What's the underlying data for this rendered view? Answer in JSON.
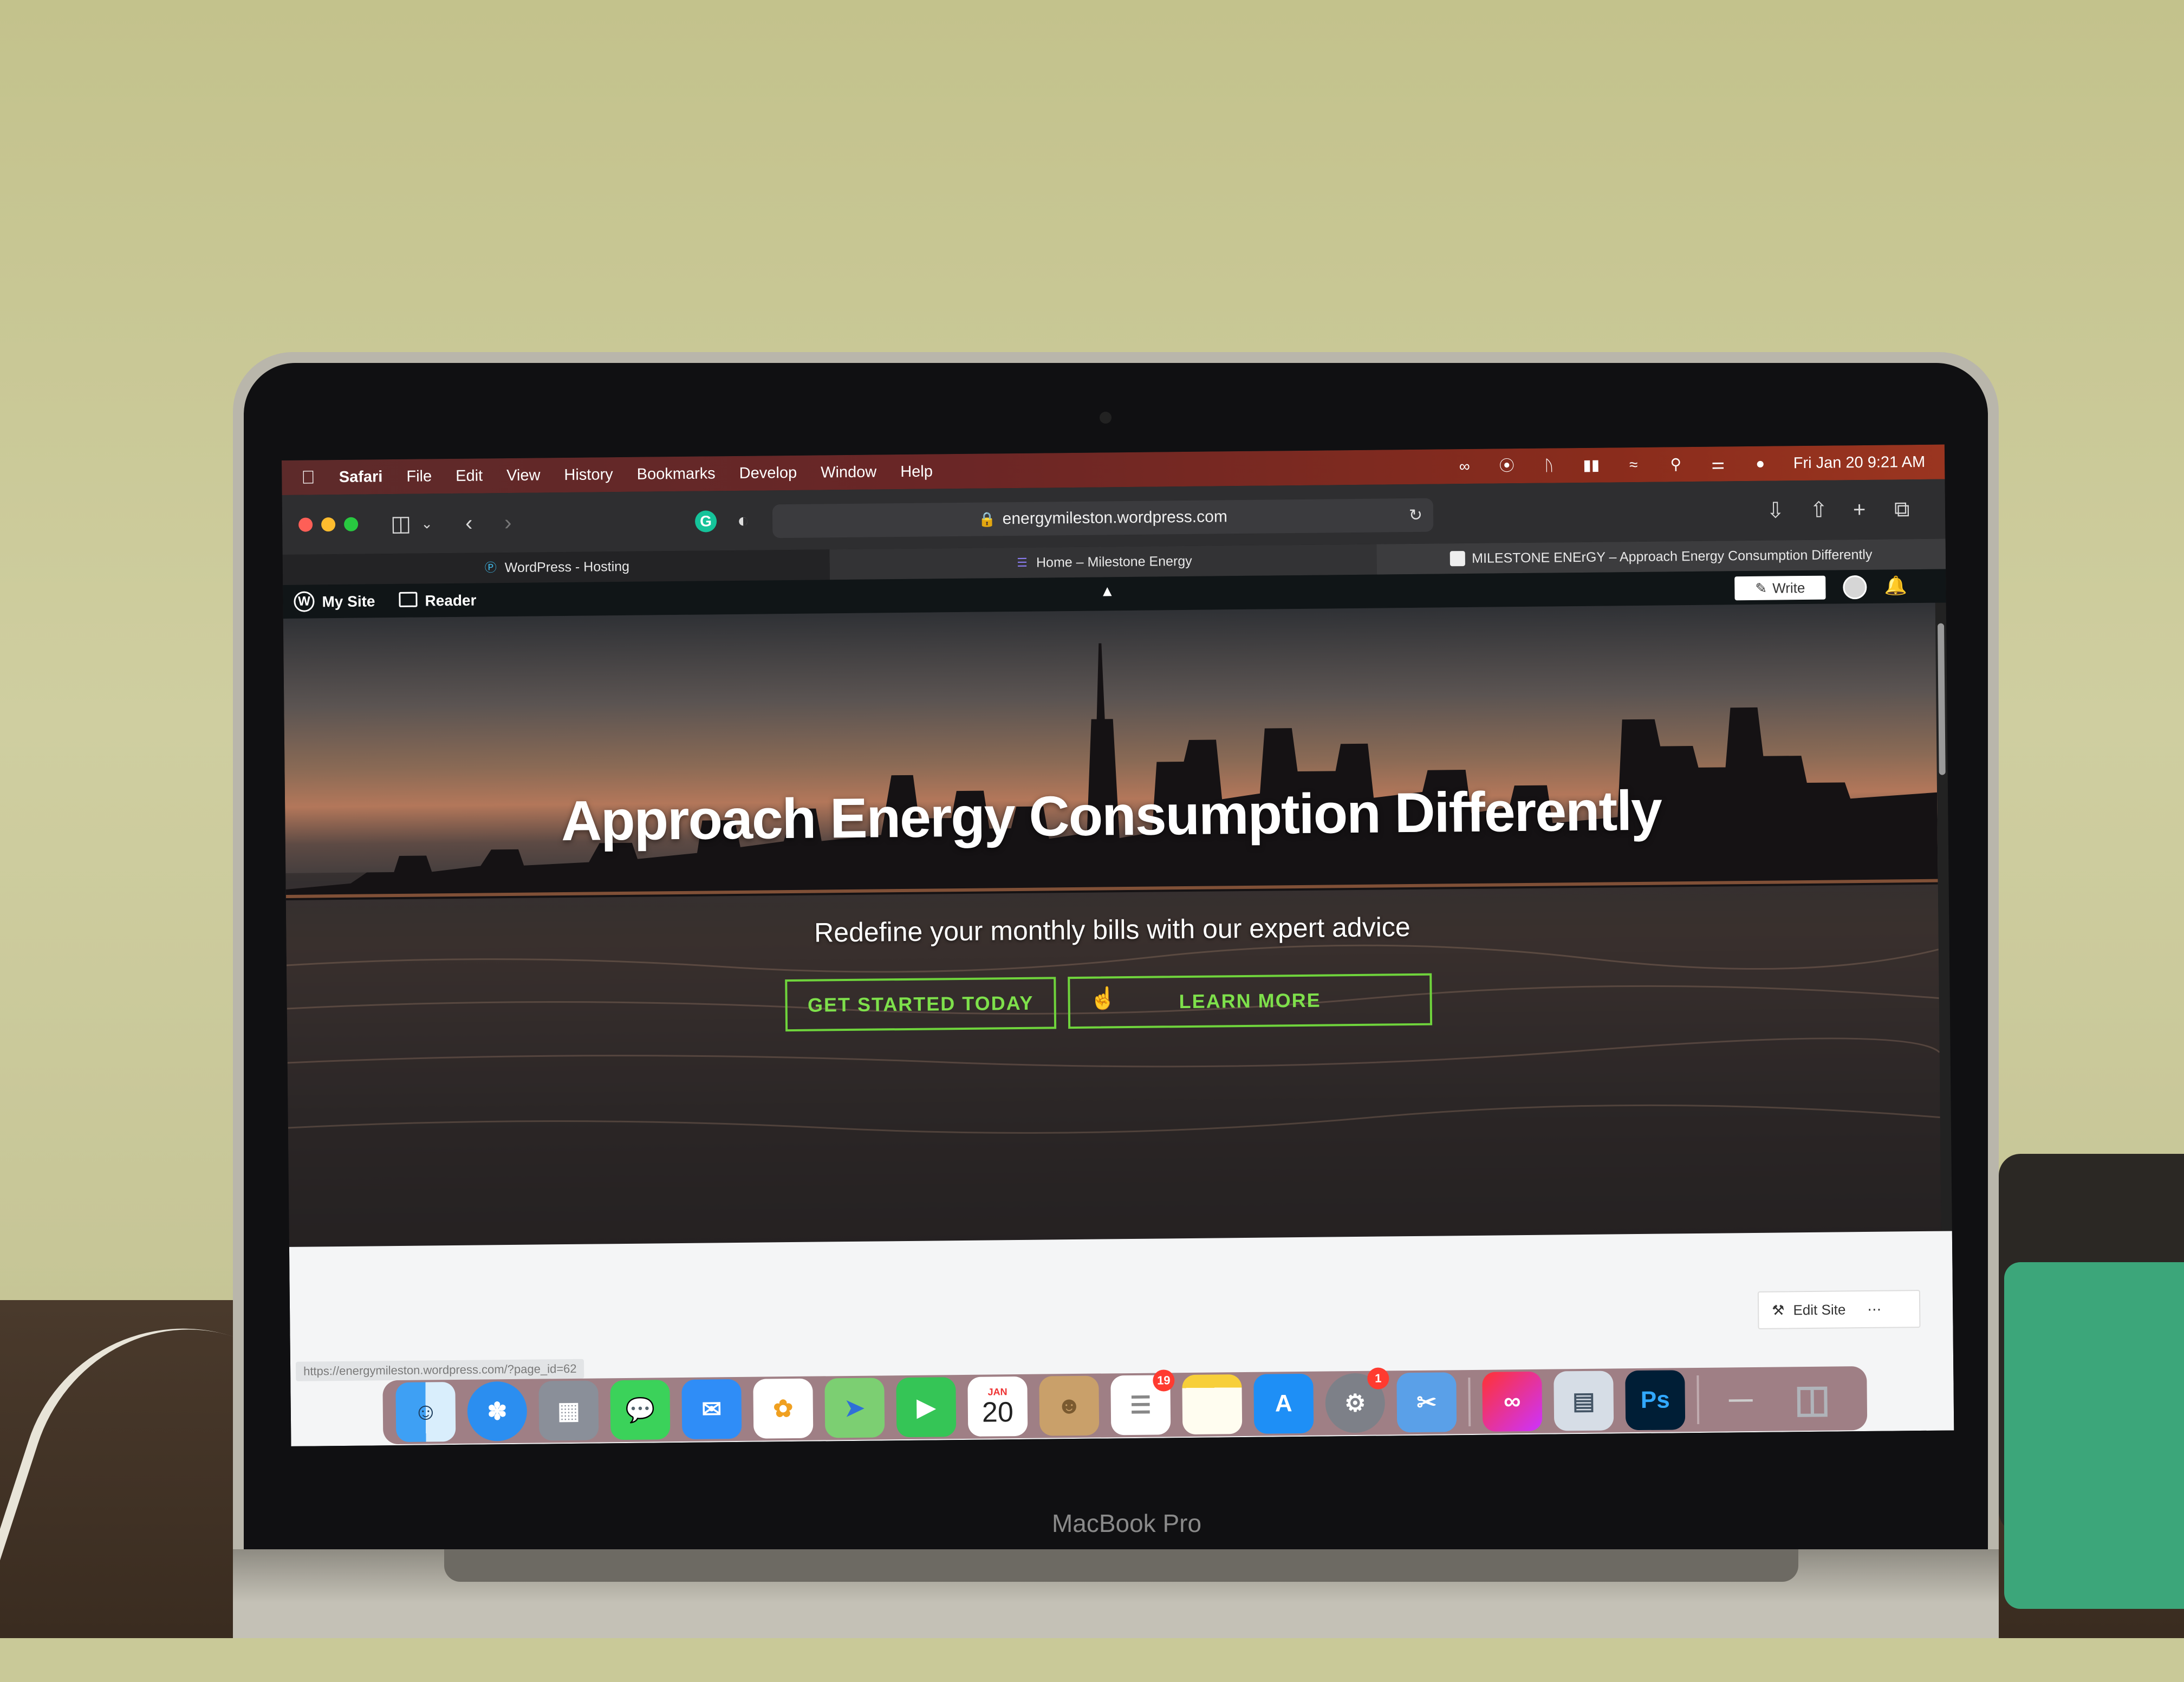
{
  "menubar": {
    "app": "Safari",
    "items": [
      "File",
      "Edit",
      "View",
      "History",
      "Bookmarks",
      "Develop",
      "Window",
      "Help"
    ],
    "datetime": "Fri Jan 20  9:21 AM"
  },
  "toolbar": {
    "url": "energymileston.wordpress.com"
  },
  "tabs": [
    {
      "title": "WordPress - Hosting"
    },
    {
      "title": "Home – Milestone Energy"
    },
    {
      "title": "MILESTONE ENErGY – Approach Energy Consumption Differently"
    }
  ],
  "wpbar": {
    "my_site": "My Site",
    "reader": "Reader",
    "write": "Write"
  },
  "hero": {
    "title": "Approach Energy Consumption Differently",
    "subtitle": "Redefine your monthly bills with our expert advice",
    "cta_primary": "GET STARTED TODAY",
    "cta_secondary": "LEARN MORE"
  },
  "page": {
    "edit_site": "Edit Site",
    "status_url": "https://energymileston.wordpress.com/?page_id=62"
  },
  "dock": {
    "calendar_month": "JAN",
    "calendar_day": "20",
    "reminders_badge": "19",
    "settings_badge": "1",
    "photoshop_label": "Ps"
  },
  "device": {
    "model": "MacBook Pro"
  },
  "colors": {
    "cta_green": "#6fd43c",
    "menubar_red": "#8a2c1c",
    "wpbar_dark": "#101517"
  }
}
